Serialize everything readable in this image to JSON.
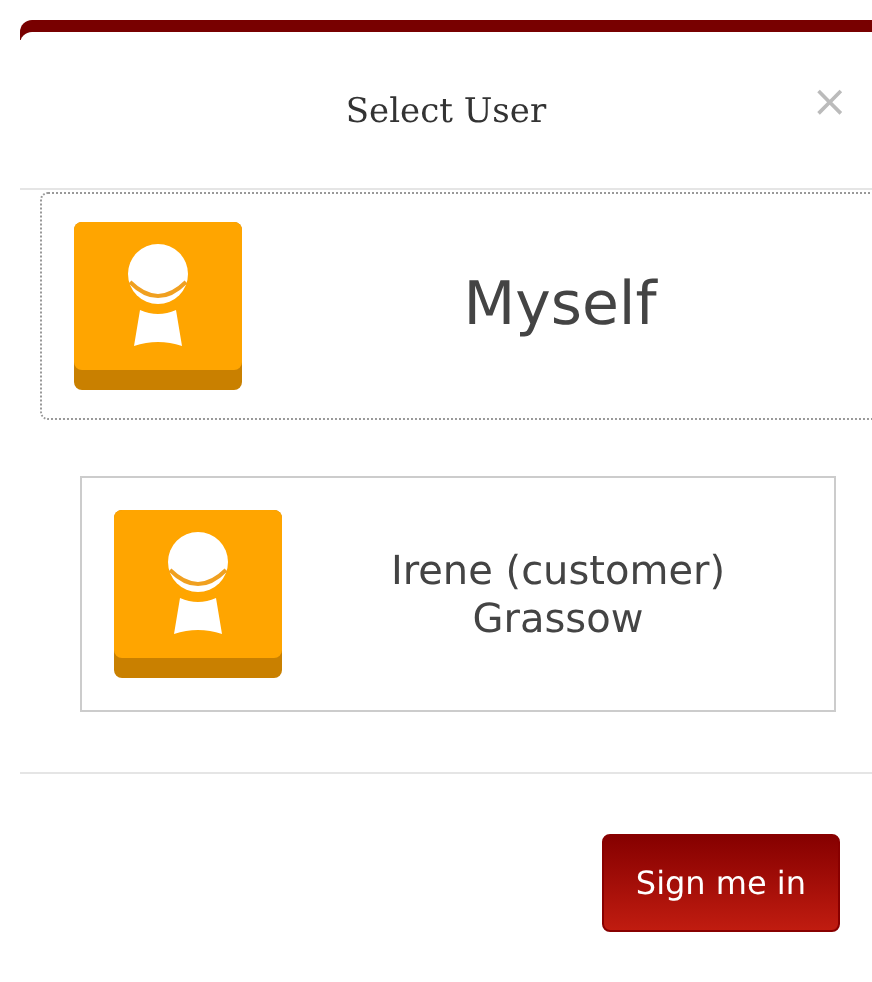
{
  "dialog": {
    "title": "Select User",
    "close": "×"
  },
  "users": [
    {
      "name": "Myself",
      "selected": true
    },
    {
      "name": "Irene (customer) Grassow",
      "selected": false
    }
  ],
  "buttons": [
    "Sign me in"
  ]
}
